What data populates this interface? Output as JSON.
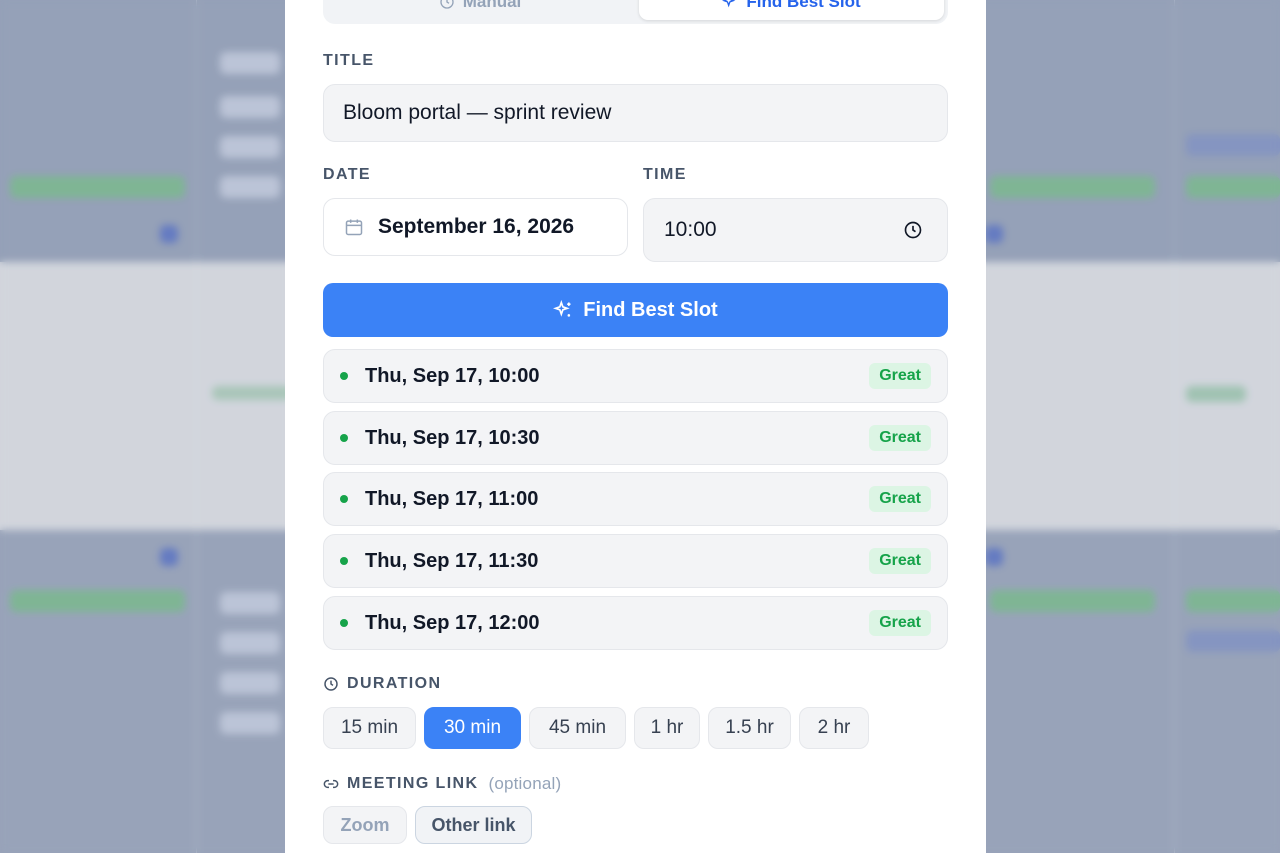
{
  "mode_switch": {
    "manual_label": "Manual",
    "find_label": "Find Best Slot"
  },
  "title_field": {
    "label": "TITLE",
    "value": "Bloom portal — sprint review"
  },
  "date_field": {
    "label": "DATE",
    "value": "September 16, 2026"
  },
  "time_field": {
    "label": "TIME",
    "value": "10:00"
  },
  "find_button": {
    "label": "Find Best Slot"
  },
  "slots": [
    {
      "when": "Thu, Sep 17, 10:00",
      "rating": "Great"
    },
    {
      "when": "Thu, Sep 17, 10:30",
      "rating": "Great"
    },
    {
      "when": "Thu, Sep 17, 11:00",
      "rating": "Great"
    },
    {
      "when": "Thu, Sep 17, 11:30",
      "rating": "Great"
    },
    {
      "when": "Thu, Sep 17, 12:00",
      "rating": "Great"
    }
  ],
  "duration": {
    "label": "DURATION",
    "options": [
      "15 min",
      "30 min",
      "45 min",
      "1 hr",
      "1.5 hr",
      "2 hr"
    ],
    "selected": "30 min"
  },
  "meeting_link": {
    "label": "MEETING LINK",
    "optional_note": "(optional)",
    "options": [
      "Zoom",
      "Other link"
    ]
  },
  "colors": {
    "accent": "#3b82f6",
    "great": "#16a34a",
    "great_bg": "#dcf5e4"
  }
}
